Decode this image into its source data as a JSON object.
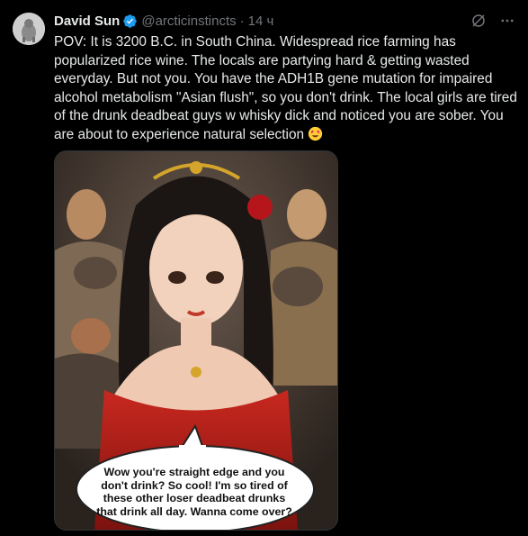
{
  "tweet": {
    "author_name": "David Sun",
    "handle": "@arcticinstincts",
    "separator": "·",
    "time": "14 ч",
    "text": "POV: It is 3200 B.C. in South China. Widespread rice farming has popularized rice wine. The locals are partying hard & getting wasted everyday. But not you. You have the ADH1B gene mutation for impaired alcohol metabolism \"Asian flush\", so you don't drink. The local girls are tired of the drunk deadbeat guys w whisky dick and noticed you are sober. You are about to experience natural selection",
    "emoji": "heart-eyes-emoji"
  },
  "media": {
    "speech_bubble": "Wow you're straight edge and you don't drink? So cool! I'm so tired of these other loser deadbeat drunks that drink all day. Wanna come over?"
  },
  "icons": {
    "verified": "verified-badge-icon",
    "grok": "grok-icon",
    "more": "more-icon"
  },
  "colors": {
    "background": "#000000",
    "text": "#e7e9ea",
    "muted": "#71767b",
    "verified": "#1d9bf0"
  }
}
